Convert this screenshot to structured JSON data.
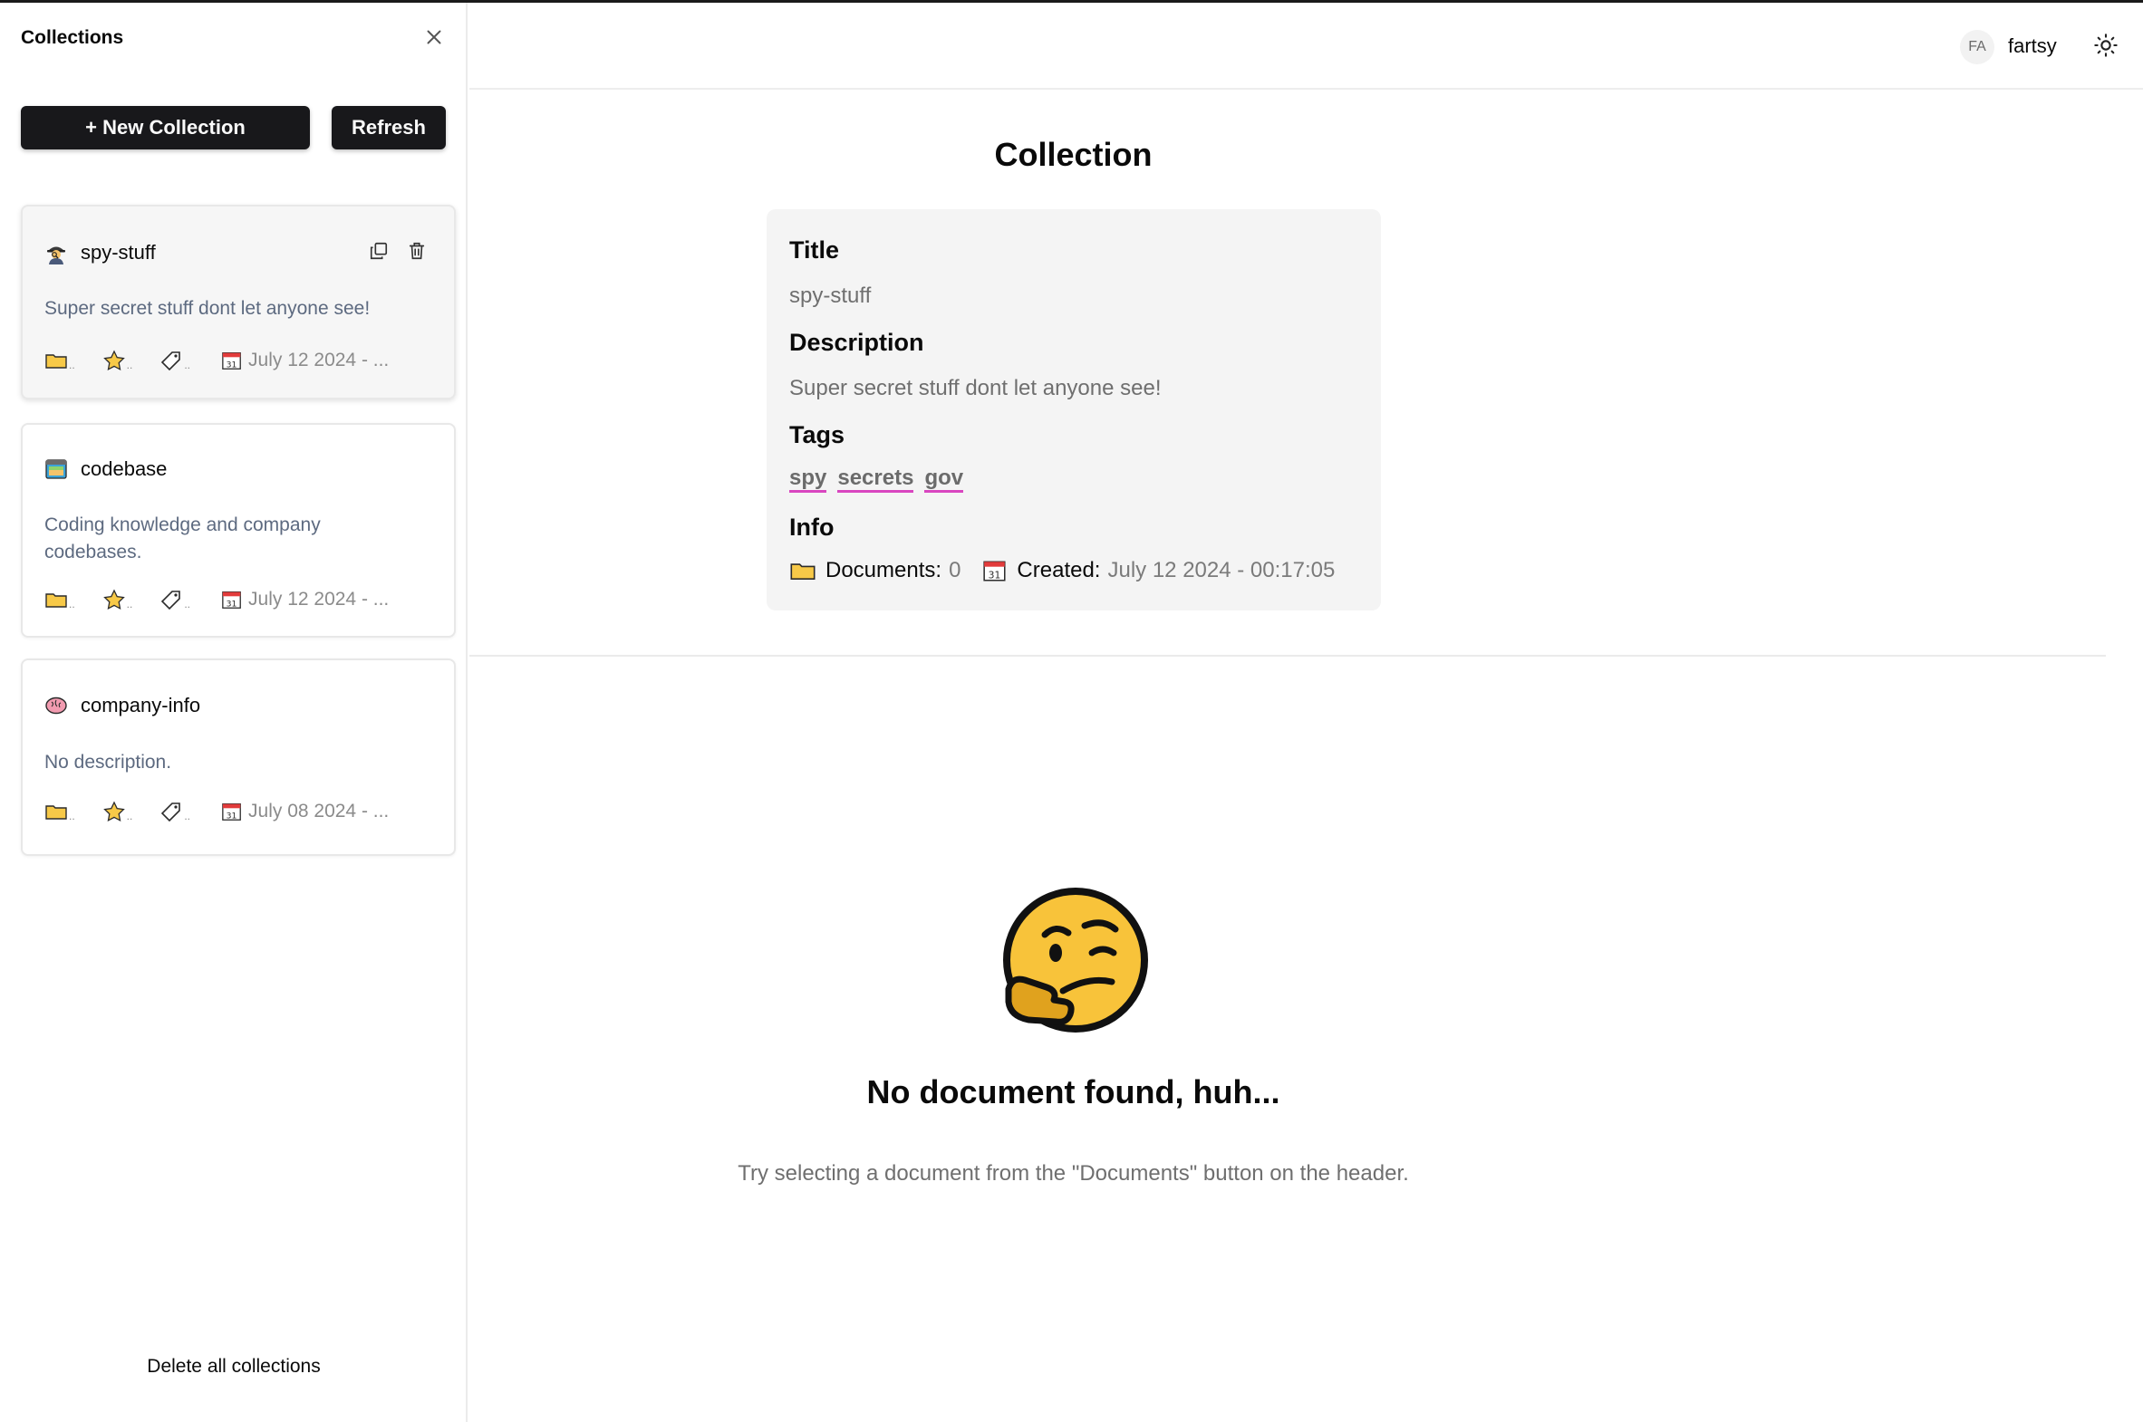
{
  "sidebar": {
    "title": "Collections",
    "new_button": "+ New Collection",
    "refresh_button": "Refresh",
    "delete_all": "Delete all collections",
    "collections": [
      {
        "name": "spy-stuff",
        "description": "Super secret stuff dont let anyone see!",
        "date": "July 12 2024 - ...",
        "emoji": "detective-icon",
        "active": true
      },
      {
        "name": "codebase",
        "description": "Coding knowledge and company codebases.",
        "date": "July 12 2024 - ...",
        "emoji": "computer-window-icon",
        "active": false
      },
      {
        "name": "company-info",
        "description": "No description.",
        "date": "July 08 2024 - ...",
        "emoji": "brain-icon",
        "active": false
      }
    ]
  },
  "header": {
    "avatar_initials": "FA",
    "username": "fartsy"
  },
  "collection": {
    "heading": "Collection",
    "title_label": "Title",
    "title_value": "spy-stuff",
    "description_label": "Description",
    "description_value": "Super secret stuff dont let anyone see!",
    "tags_label": "Tags",
    "tags": [
      "spy",
      "secrets",
      "gov"
    ],
    "info_label": "Info",
    "documents_label": "Documents:",
    "documents_count": "0",
    "created_label": "Created:",
    "created_value": "July 12 2024 - 00:17:05"
  },
  "empty_state": {
    "title": "No document found, huh...",
    "subtitle": "Try selecting a document from the \"Documents\" button on the header."
  },
  "colors": {
    "accent_dark": "#18181b",
    "tag_underline": "#d946c0",
    "description_text": "#5d6a80"
  }
}
